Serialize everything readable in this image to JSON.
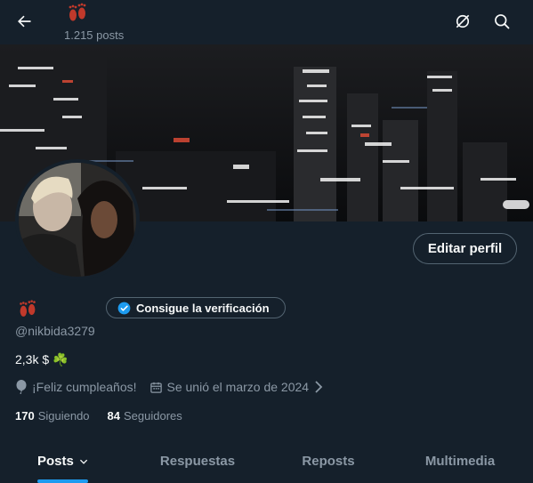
{
  "header": {
    "title_emoji": "👣",
    "post_count": "1.215 posts",
    "back_icon": "arrow-left-icon",
    "actions": [
      "unsubscribe-circle-icon",
      "search-icon"
    ]
  },
  "profile": {
    "name_emoji": "👣",
    "verify_label": "Consigue la verificación",
    "edit_label": "Editar perfil",
    "handle": "@nikbida3279",
    "bio": "2,3k $ ☘️",
    "location": "¡Feliz cumpleaños!",
    "joined": "Se unió el marzo de 2024",
    "following_count": "170",
    "following_label": "Siguiendo",
    "followers_count": "84",
    "followers_label": "Seguidores"
  },
  "tabs": [
    {
      "label": "Posts",
      "active": true
    },
    {
      "label": "Respuestas",
      "active": false
    },
    {
      "label": "Reposts",
      "active": false
    },
    {
      "label": "Multimedia",
      "active": false
    }
  ],
  "colors": {
    "background": "#15202b",
    "accent": "#1d9bf0",
    "muted_text": "#8b98a5",
    "primary_text": "#f7f9f9",
    "footprint_red": "#c0392b"
  }
}
